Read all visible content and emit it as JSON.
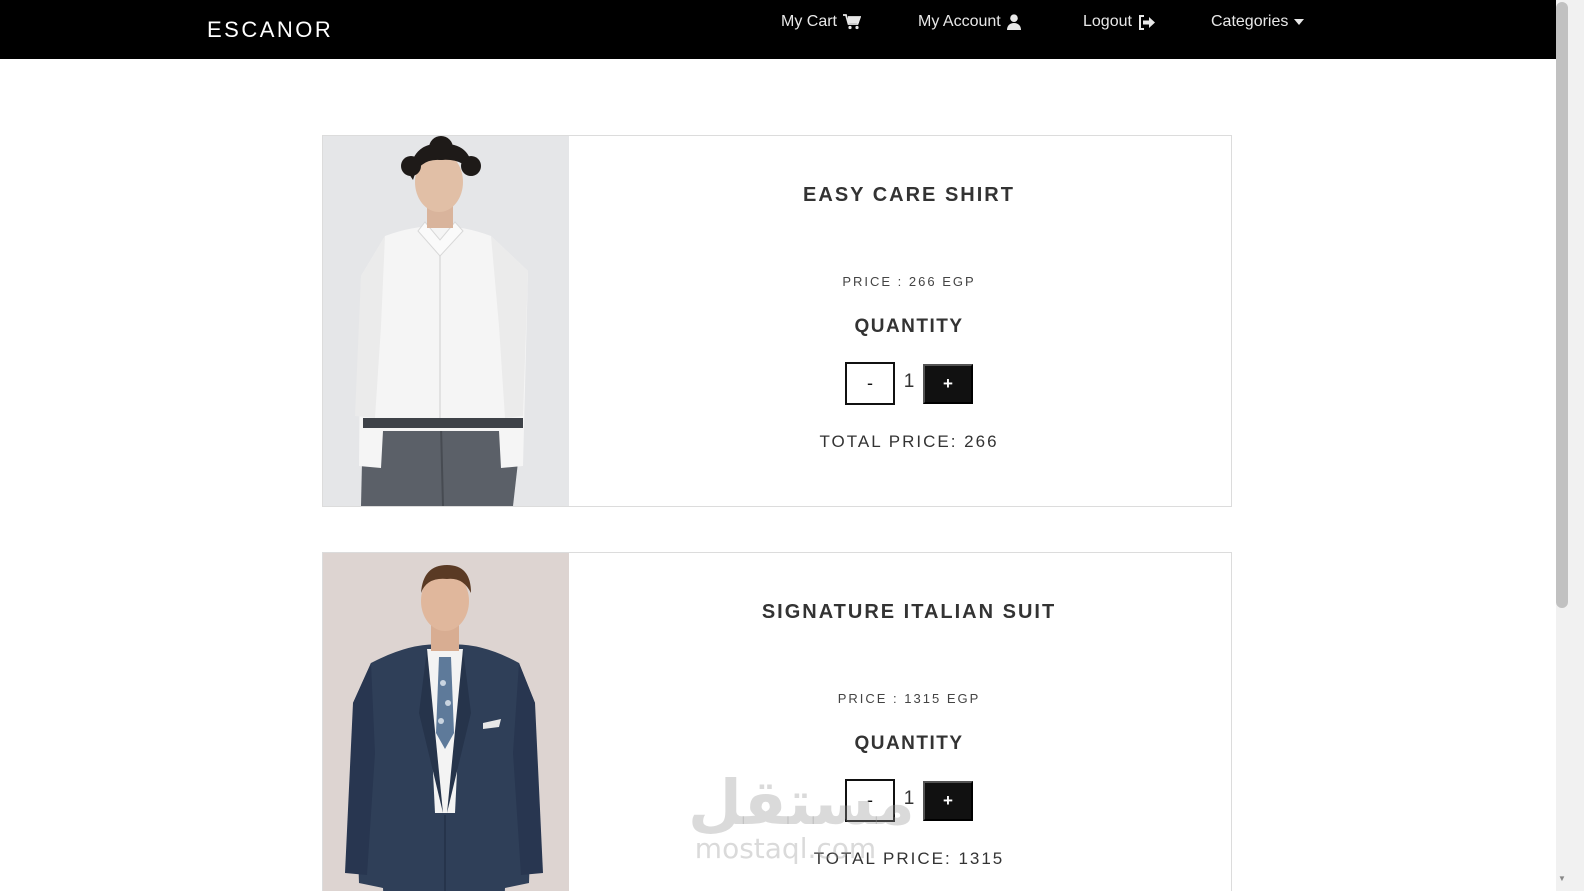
{
  "navbar": {
    "brand": "ESCANOR",
    "items": [
      {
        "label": "My Cart",
        "icon": "cart-icon"
      },
      {
        "label": "My Account",
        "icon": "user-icon"
      },
      {
        "label": "Logout",
        "icon": "sign-out-icon"
      },
      {
        "label": "Categories",
        "icon": "caret-down-icon"
      }
    ]
  },
  "cart": {
    "items": [
      {
        "title": "EASY CARE SHIRT",
        "price_text": "PRICE : 266 EGP",
        "quantity_label": "QUANTITY",
        "minus_label": "-",
        "quantity": "1",
        "plus_label": "+",
        "total_text": "TOTAL PRICE: 266"
      },
      {
        "title": "SIGNATURE ITALIAN SUIT",
        "price_text": "PRICE : 1315 EGP",
        "quantity_label": "QUANTITY",
        "minus_label": "-",
        "quantity": "1",
        "plus_label": "+",
        "total_text": "TOTAL PRICE: 1315"
      }
    ]
  },
  "watermark": {
    "arabic": "مستقل",
    "latin": "mostaql.com"
  },
  "colors": {
    "navbar_bg": "#000000",
    "button_dark": "#111111",
    "card_border": "#dcdcdc"
  }
}
